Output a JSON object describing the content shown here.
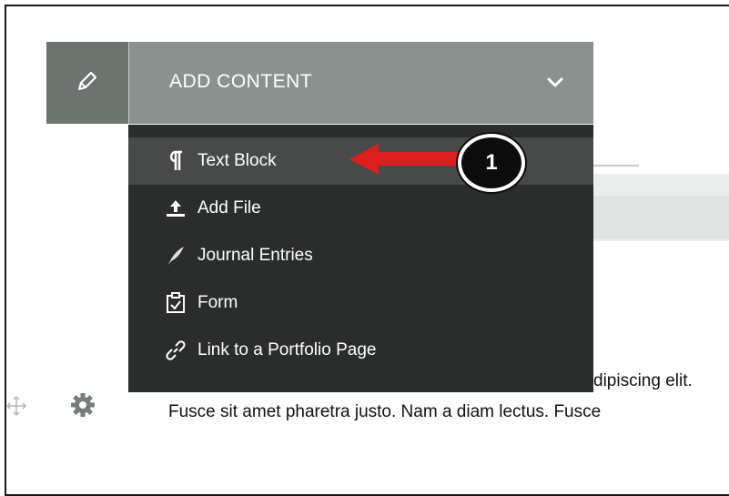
{
  "toolbar": {
    "edit_icon": "pencil-icon",
    "add_content_label": "ADD CONTENT",
    "dropdown_icon": "chevron-down-icon"
  },
  "dropdown": {
    "items": [
      {
        "label": "Text Block",
        "icon": "pilcrow-icon",
        "active": true
      },
      {
        "label": "Add File",
        "icon": "upload-icon"
      },
      {
        "label": "Journal Entries",
        "icon": "quill-icon"
      },
      {
        "label": "Form",
        "icon": "clipboard-check-icon"
      },
      {
        "label": "Link to a Portfolio Page",
        "icon": "link-icon"
      }
    ]
  },
  "annotation": {
    "step_number": "1",
    "arrow_color": "#dd1f1f"
  },
  "content": {
    "line1_fragment": "dipiscing elit.",
    "line2": "Fusce sit amet pharetra justo. Nam a diam lectus. Fusce"
  },
  "colors": {
    "toolbar_edit_bg": "#6d7470",
    "toolbar_add_bg": "#8a918e",
    "dropdown_bg": "#2b2d2c",
    "dropdown_active_bg": "#474a48"
  }
}
